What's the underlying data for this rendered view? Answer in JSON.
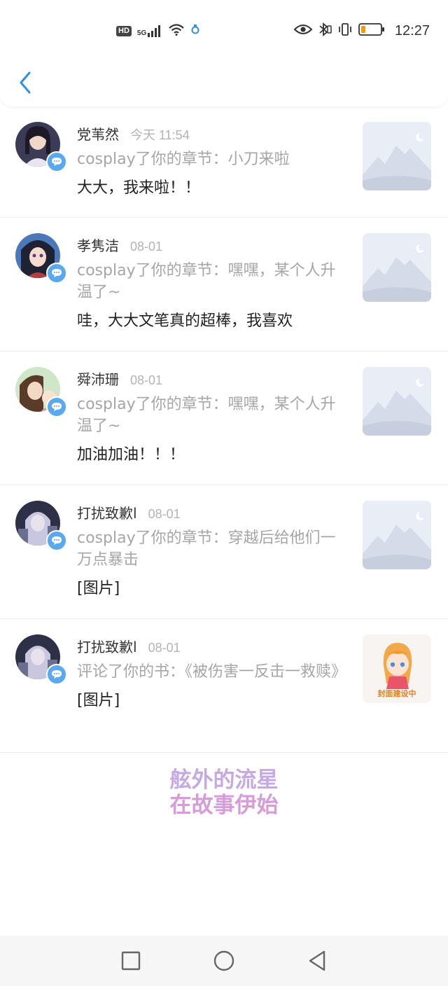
{
  "status_bar": {
    "hd_label": "HD",
    "signal_label": "5G",
    "time": "12:27",
    "icons": [
      "hd-icon",
      "signal-icon",
      "wifi-icon",
      "notification-icon",
      "eye-icon",
      "bluetooth-icon",
      "vibrate-icon",
      "battery-icon"
    ],
    "battery_color": "#f39c12"
  },
  "header": {
    "back_icon": "chevron-left-icon",
    "accent": "#2f8fe0"
  },
  "items": [
    {
      "name": "党苇然",
      "time": "今天 11:54",
      "action": "cosplay了你的章节：小刀来啦",
      "comment": "大大，我来啦！！",
      "thumb_type": "placeholder"
    },
    {
      "name": "孝隽洁",
      "time": "08-01",
      "action": "cosplay了你的章节：嘿嘿，某个人升温了~",
      "comment": "哇，大大文笔真的超棒，我喜欢",
      "thumb_type": "placeholder"
    },
    {
      "name": "舜沛珊",
      "time": "08-01",
      "action": "cosplay了你的章节：嘿嘿，某个人升温了~",
      "comment": "加油加油！！！",
      "thumb_type": "placeholder"
    },
    {
      "name": "打扰致歉l",
      "time": "08-01",
      "action": "cosplay了你的章节：穿越后给他们一万点暴击",
      "comment": "[图片]",
      "thumb_type": "placeholder"
    },
    {
      "name": "打扰致歉l",
      "time": "08-01",
      "action": "评论了你的书：《被伤害一反击一救赎》",
      "comment": "[图片]",
      "thumb_type": "cover",
      "cover_text": "封面建设中"
    }
  ],
  "signature": {
    "line1": "舷外的流星",
    "line2": "在故事伊始"
  },
  "nav": {
    "icons": [
      "recent-apps-icon",
      "home-icon",
      "back-triangle-icon"
    ]
  }
}
